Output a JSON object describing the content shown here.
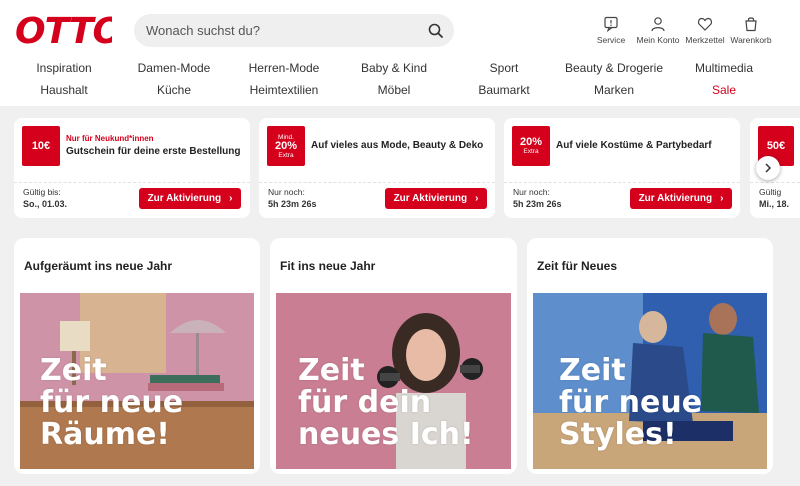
{
  "brand": {
    "logo_text": "OTTO",
    "accent": "#d4001c"
  },
  "search": {
    "placeholder": "Wonach suchst du?",
    "icon": "search-icon"
  },
  "header_actions": [
    {
      "label": "Service",
      "icon": "service-icon"
    },
    {
      "label": "Mein Konto",
      "icon": "account-icon"
    },
    {
      "label": "Merkzettel",
      "icon": "heart-icon"
    },
    {
      "label": "Warenkorb",
      "icon": "cart-icon"
    }
  ],
  "nav": {
    "row1": [
      "Inspiration",
      "Damen-Mode",
      "Herren-Mode",
      "Baby & Kind",
      "Sport",
      "Beauty & Drogerie",
      "Multimedia"
    ],
    "row2": [
      "Haushalt",
      "Küche",
      "Heimtextilien",
      "Möbel",
      "Baumarkt",
      "Marken",
      "Sale"
    ]
  },
  "coupons": [
    {
      "badge_main": "10€",
      "badge_top": "",
      "badge_bottom": "",
      "kicker": "Nur für Neukund*innen",
      "title": "Gutschein für deine erste Bestellung",
      "meta_label": "Gültig bis:",
      "meta_value": "So., 01.03.",
      "button": "Zur Aktivierung"
    },
    {
      "badge_main": "20%",
      "badge_top": "Mind.",
      "badge_bottom": "Extra",
      "kicker": "",
      "title": "Auf vieles aus Mode, Beauty & Deko",
      "meta_label": "Nur noch:",
      "meta_value": "5h 23m 26s",
      "button": "Zur Aktivierung"
    },
    {
      "badge_main": "20%",
      "badge_top": "",
      "badge_bottom": "Extra",
      "kicker": "",
      "title": "Auf viele Kostüme & Partybedarf",
      "meta_label": "Nur noch:",
      "meta_value": "5h 23m 26s",
      "button": "Zur Aktivierung"
    },
    {
      "badge_main": "50€",
      "badge_top": "",
      "badge_bottom": "",
      "kicker": "",
      "title": "",
      "meta_label": "Gültig",
      "meta_value": "Mi., 18.",
      "button": ""
    }
  ],
  "teasers": [
    {
      "title": "Aufgeräumt ins neue Jahr",
      "line1": "Zeit",
      "line2": "für neue",
      "line3": "Räume!"
    },
    {
      "title": "Fit ins neue Jahr",
      "line1": "Zeit",
      "line2": "für dein",
      "line3": "neues Ich!"
    },
    {
      "title": "Zeit für Neues",
      "line1": "Zeit",
      "line2": "für neue",
      "line3": "Styles!"
    }
  ]
}
